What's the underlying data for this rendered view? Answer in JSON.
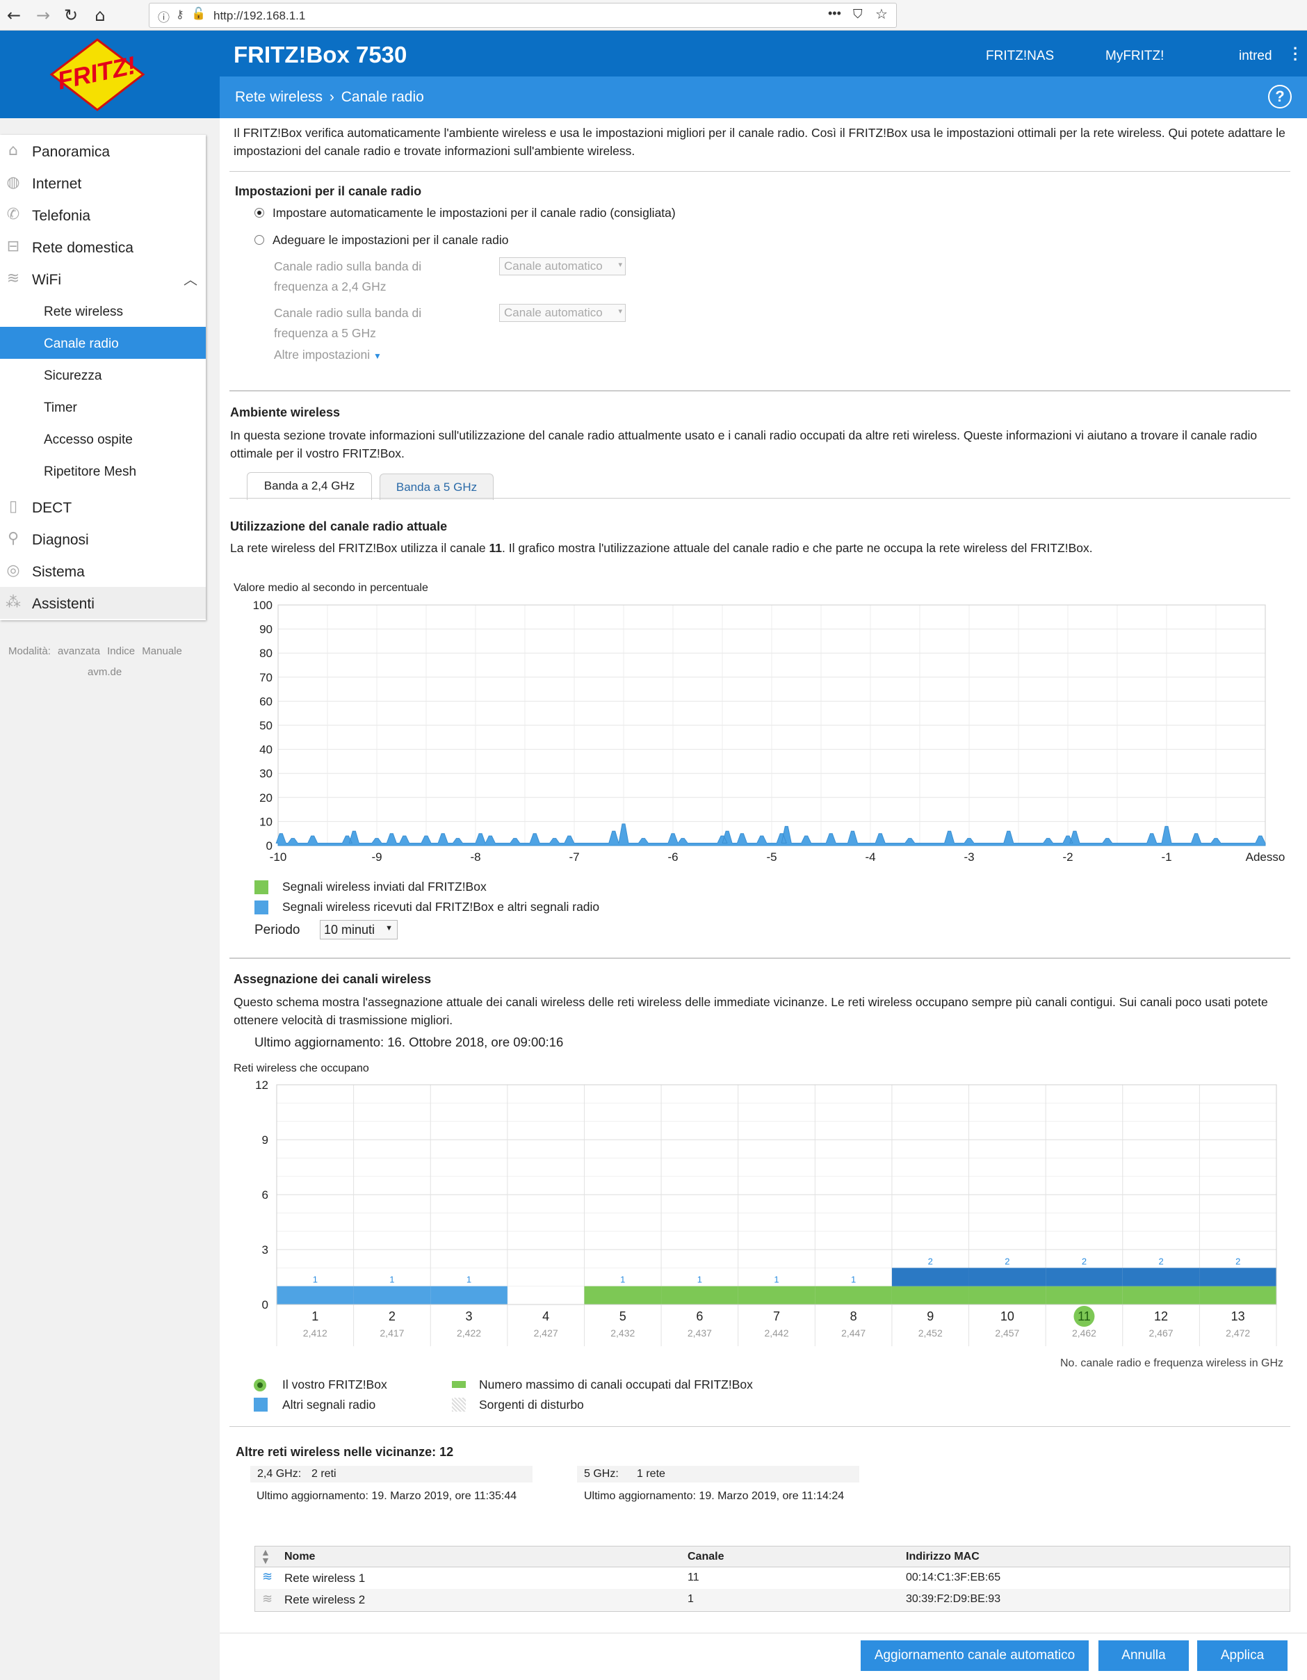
{
  "browser": {
    "url": "http://192.168.1.1",
    "more": "•••"
  },
  "header": {
    "logo_text": "FRITZ!",
    "title": "FRITZ!Box 7530",
    "links": [
      "FRITZ!NAS",
      "MyFRITZ!"
    ],
    "user": "intred",
    "breadcrumb": [
      "Rete wireless",
      "Canale radio"
    ],
    "help": "?"
  },
  "sidebar": {
    "items": [
      {
        "label": "Panoramica",
        "icon": "home-icon"
      },
      {
        "label": "Internet",
        "icon": "globe-icon"
      },
      {
        "label": "Telefonia",
        "icon": "phone-icon"
      },
      {
        "label": "Rete domestica",
        "icon": "network-icon"
      },
      {
        "label": "WiFi",
        "icon": "wifi-icon"
      },
      {
        "label": "DECT",
        "icon": "dect-icon"
      },
      {
        "label": "Diagnosi",
        "icon": "diagnosis-icon"
      },
      {
        "label": "Sistema",
        "icon": "system-icon"
      },
      {
        "label": "Assistenti",
        "icon": "wizard-icon"
      }
    ],
    "wifi_sub": [
      "Rete wireless",
      "Canale radio",
      "Sicurezza",
      "Timer",
      "Accesso ospite",
      "Ripetitore Mesh"
    ],
    "active_sub": "Canale radio",
    "footer": [
      "Modalità: avanzata",
      "Indice",
      "Manuale"
    ],
    "avm": "avm.de"
  },
  "intro": "Il FRITZ!Box verifica automaticamente l'ambiente wireless e usa le impostazioni migliori per il canale radio. Così il FRITZ!Box usa le impostazioni ottimali per la rete wireless. Qui potete adattare le impostazioni del canale radio e trovate informazioni sull'ambiente wireless.",
  "settings": {
    "heading": "Impostazioni per il canale radio",
    "option_auto": "Impostare automaticamente le impostazioni per il canale radio (consigliata)",
    "option_manual": "Adeguare le impostazioni per il canale radio",
    "band24_label_1": "Canale radio sulla banda di",
    "band24_label_2": "frequenza a 2,4 GHz",
    "band5_label_1": "Canale radio sulla banda di",
    "band5_label_2": "frequenza a 5 GHz",
    "select_value": "Canale automatico",
    "more": "Altre impostazioni"
  },
  "environment": {
    "heading": "Ambiente wireless",
    "text": "In questa sezione trovate informazioni sull'utilizzazione del canale radio attualmente usato e i canali radio occupati da altre reti wireless. Queste informazioni vi aiutano a trovare il canale radio ottimale per il vostro FRITZ!Box.",
    "tabs": [
      "Banda a 2,4 GHz",
      "Banda a 5 GHz"
    ]
  },
  "usage": {
    "heading": "Utilizzazione del canale radio attuale",
    "text_pre": "La rete wireless del FRITZ!Box utilizza il canale ",
    "channel": "11",
    "text_post": ". Il grafico mostra l'utilizzazione attuale del canale radio e che parte ne occupa la rete wireless del FRITZ!Box.",
    "legend_sent": "Segnali wireless inviati dal FRITZ!Box",
    "legend_received": "Segnali wireless ricevuti dal FRITZ!Box e altri segnali radio",
    "period_label": "Periodo",
    "period_value": "10 minuti"
  },
  "assignment": {
    "heading": "Assegnazione dei canali wireless",
    "text": "Questo schema mostra l'assegnazione attuale dei canali wireless delle reti wireless delle immediate vicinanze. Le reti wireless occupano sempre più canali contigui. Sui canali poco usati potete ottenere velocità di trasmissione migliori.",
    "updated": "Ultimo aggiornamento: 16. Ottobre 2018, ore 09:00:16",
    "axis_caption": "No. canale radio e frequenza wireless in GHz",
    "legend": [
      "Il vostro FRITZ!Box",
      "Numero massimo di canali occupati dal FRITZ!Box",
      "Altri segnali radio",
      "Sorgenti di disturbo"
    ]
  },
  "nearby": {
    "heading": "Altre reti wireless nelle vicinanze: 12",
    "g24_label": "2,4 GHz:",
    "g24_value": "2  reti",
    "g24_updated": "Ultimo aggiornamento: 19. Marzo 2019, ore 11:35:44",
    "g5_label": "5 GHz:",
    "g5_value": "1 rete",
    "g5_updated": "Ultimo aggiornamento: 19. Marzo 2019, ore 11:14:24",
    "columns": [
      "Nome",
      "Canale",
      "Indirizzo MAC"
    ],
    "rows": [
      {
        "name": "Rete wireless 1",
        "channel": "11",
        "mac": "00:14:C1:3F:EB:65"
      },
      {
        "name": "Rete wireless 2",
        "channel": "1",
        "mac": "30:39:F2:D9:BE:93"
      }
    ]
  },
  "buttons": {
    "auto": "Aggiornamento canale automatico",
    "cancel": "Annulla",
    "apply": "Applica"
  },
  "colors": {
    "brand_blue": "#0b6fc4",
    "accent_blue": "#2d8ee0",
    "green": "#7dc855",
    "received_blue": "#4ea3e4",
    "dark_blue": "#2b79c4"
  },
  "chart_data": [
    {
      "type": "area",
      "title": "Valore medio al secondo in percentuale",
      "x_ticks": [
        "-10",
        "-9",
        "-8",
        "-7",
        "-6",
        "-5",
        "-4",
        "-3",
        "-2",
        "-1",
        "Adesso"
      ],
      "y_ticks": [
        0,
        10,
        20,
        30,
        40,
        50,
        60,
        70,
        80,
        90,
        100
      ],
      "ylim": [
        0,
        100
      ],
      "xlim": [
        -10,
        0
      ],
      "baseline": 1,
      "series": [
        {
          "name": "Segnali wireless ricevuti dal FRITZ!Box e altri segnali radio",
          "spikes": [
            [
              -9.97,
              5
            ],
            [
              -9.85,
              3
            ],
            [
              -9.65,
              4
            ],
            [
              -9.3,
              4
            ],
            [
              -9.23,
              6
            ],
            [
              -9.0,
              3
            ],
            [
              -8.85,
              5
            ],
            [
              -8.72,
              4
            ],
            [
              -8.5,
              4
            ],
            [
              -8.33,
              5
            ],
            [
              -8.18,
              3
            ],
            [
              -7.95,
              5
            ],
            [
              -7.85,
              4
            ],
            [
              -7.6,
              3
            ],
            [
              -7.4,
              5
            ],
            [
              -7.2,
              3
            ],
            [
              -7.05,
              4
            ],
            [
              -6.6,
              6
            ],
            [
              -6.5,
              9
            ],
            [
              -6.3,
              3
            ],
            [
              -6.0,
              5
            ],
            [
              -5.9,
              3
            ],
            [
              -5.5,
              4
            ],
            [
              -5.45,
              6
            ],
            [
              -5.3,
              5
            ],
            [
              -5.1,
              4
            ],
            [
              -4.9,
              5
            ],
            [
              -4.85,
              8
            ],
            [
              -4.65,
              4
            ],
            [
              -4.4,
              5
            ],
            [
              -4.18,
              6
            ],
            [
              -3.9,
              5
            ],
            [
              -3.6,
              3
            ],
            [
              -3.2,
              6
            ],
            [
              -3.0,
              3
            ],
            [
              -2.6,
              6
            ],
            [
              -2.2,
              3
            ],
            [
              -2.0,
              4
            ],
            [
              -1.93,
              6
            ],
            [
              -1.6,
              3
            ],
            [
              -1.15,
              5
            ],
            [
              -1.0,
              8
            ],
            [
              -0.7,
              5
            ],
            [
              -0.5,
              3
            ],
            [
              -0.05,
              4
            ]
          ]
        }
      ]
    },
    {
      "type": "bar",
      "title": "Reti wireless che occupano",
      "categories": [
        "1",
        "2",
        "3",
        "4",
        "5",
        "6",
        "7",
        "8",
        "9",
        "10",
        "11",
        "12",
        "13"
      ],
      "frequencies": [
        "2,412",
        "2,417",
        "2,422",
        "2,427",
        "2,432",
        "2,437",
        "2,442",
        "2,447",
        "2,452",
        "2,457",
        "2,462",
        "2,467",
        "2,472"
      ],
      "y_ticks": [
        0,
        3,
        6,
        9,
        12
      ],
      "ylim": [
        0,
        12
      ],
      "series": [
        {
          "name": "Altri segnali radio",
          "values": [
            1,
            1,
            1,
            0,
            1,
            1,
            1,
            1,
            2,
            2,
            2,
            2,
            2
          ]
        },
        {
          "name": "Numero massimo di canali occupati dal FRITZ!Box",
          "values": [
            0,
            0,
            0,
            0,
            1,
            1,
            1,
            1,
            1,
            1,
            1,
            1,
            1
          ]
        }
      ],
      "own_channel": "11"
    }
  ]
}
